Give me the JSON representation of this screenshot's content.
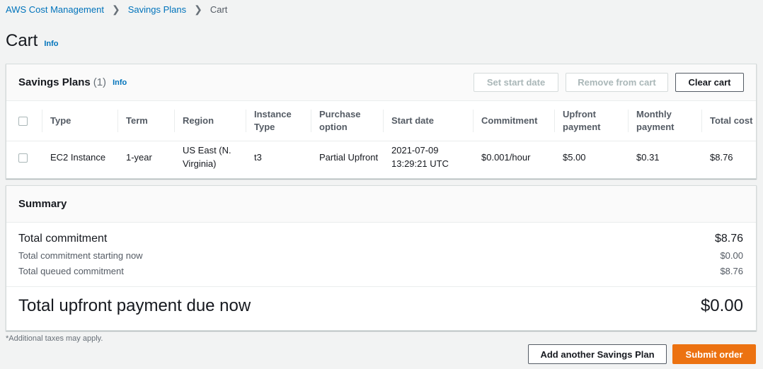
{
  "breadcrumb": {
    "items": [
      "AWS Cost Management",
      "Savings Plans",
      "Cart"
    ]
  },
  "page": {
    "title": "Cart",
    "info": "Info"
  },
  "plans": {
    "title": "Savings Plans",
    "count": "(1)",
    "info": "Info",
    "buttons": {
      "set_start_date": "Set start date",
      "remove_from_cart": "Remove from cart",
      "clear_cart": "Clear cart"
    },
    "columns": [
      "Type",
      "Term",
      "Region",
      "Instance Type",
      "Purchase option",
      "Start date",
      "Commitment",
      "Upfront payment",
      "Monthly payment",
      "Total cost"
    ],
    "rows": [
      {
        "type": "EC2 Instance",
        "term": "1-year",
        "region": "US East (N. Virginia)",
        "instance_type": "t3",
        "purchase_option": "Partial Upfront",
        "start_date": "2021-07-09 13:29:21 UTC",
        "commitment": "$0.001/hour",
        "upfront": "$5.00",
        "monthly": "$0.31",
        "total": "$8.76"
      }
    ]
  },
  "summary": {
    "title": "Summary",
    "total_commitment_label": "Total commitment",
    "total_commitment_value": "$8.76",
    "starting_now_label": "Total commitment starting now",
    "starting_now_value": "$0.00",
    "queued_label": "Total queued commitment",
    "queued_value": "$8.76",
    "due_label": "Total upfront payment due now",
    "due_value": "$0.00"
  },
  "footnote": "*Additional taxes may apply.",
  "actions": {
    "add_another": "Add another Savings Plan",
    "submit": "Submit order"
  },
  "colors": {
    "link": "#0073bb",
    "primary": "#ec7211",
    "background": "#f2f3f3"
  }
}
